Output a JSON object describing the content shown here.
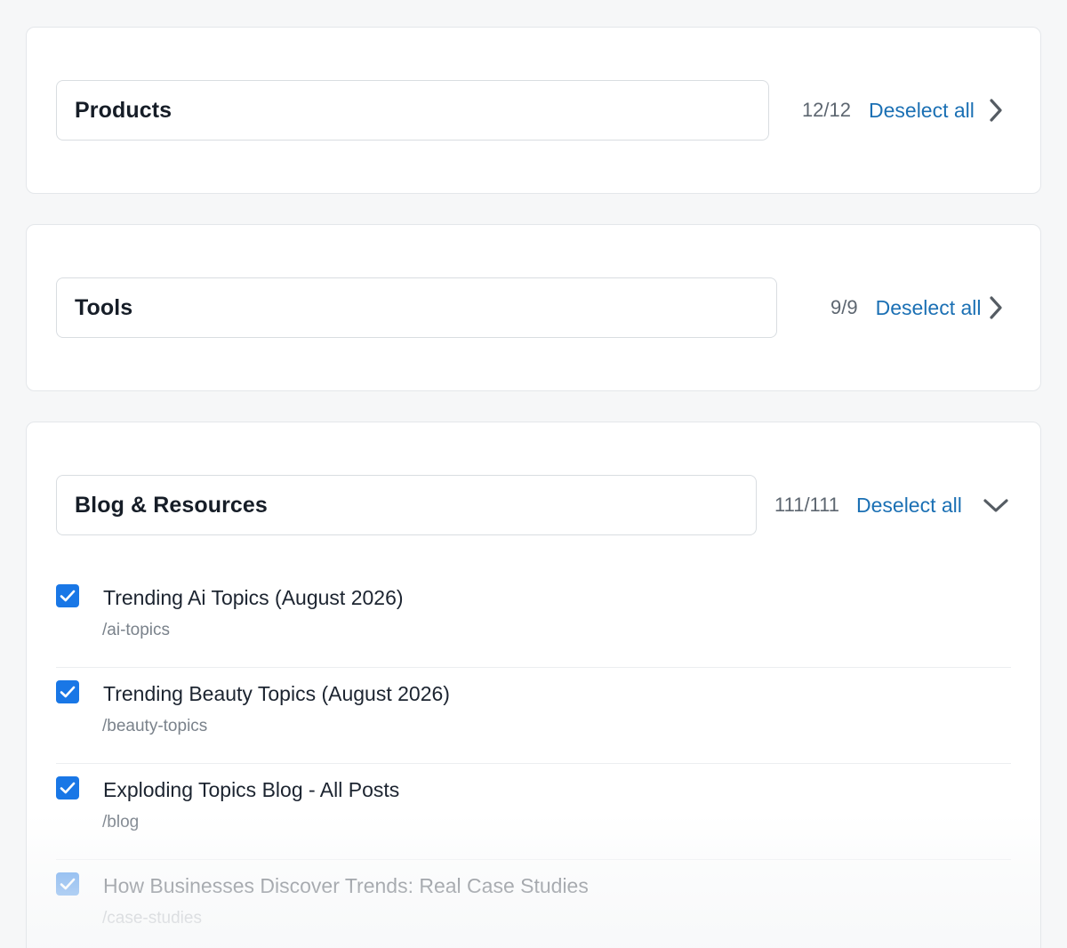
{
  "sections": [
    {
      "name": "Products",
      "count": "12/12",
      "deselect_label": "Deselect all",
      "expanded": false
    },
    {
      "name": "Tools",
      "count": "9/9",
      "deselect_label": "Deselect all",
      "expanded": false
    },
    {
      "name": "Blog & Resources",
      "count": "111/111",
      "deselect_label": "Deselect all",
      "expanded": true,
      "items": [
        {
          "title": "Trending Ai Topics (August 2026)",
          "path": "/ai-topics",
          "checked": true
        },
        {
          "title": "Trending Beauty Topics (August 2026)",
          "path": "/beauty-topics",
          "checked": true
        },
        {
          "title": "Exploding Topics Blog - All Posts",
          "path": "/blog",
          "checked": true
        },
        {
          "title": "How Businesses Discover Trends: Real Case Studies",
          "path": "/case-studies",
          "checked": true
        }
      ]
    }
  ],
  "icons": {
    "collapsed": "chevron-right-icon",
    "expanded": "chevron-down-icon",
    "checkbox": "checkmark-icon"
  },
  "colors": {
    "accent_link": "#1b70b4",
    "checkbox": "#1977e6",
    "background": "#f6f7f8"
  }
}
